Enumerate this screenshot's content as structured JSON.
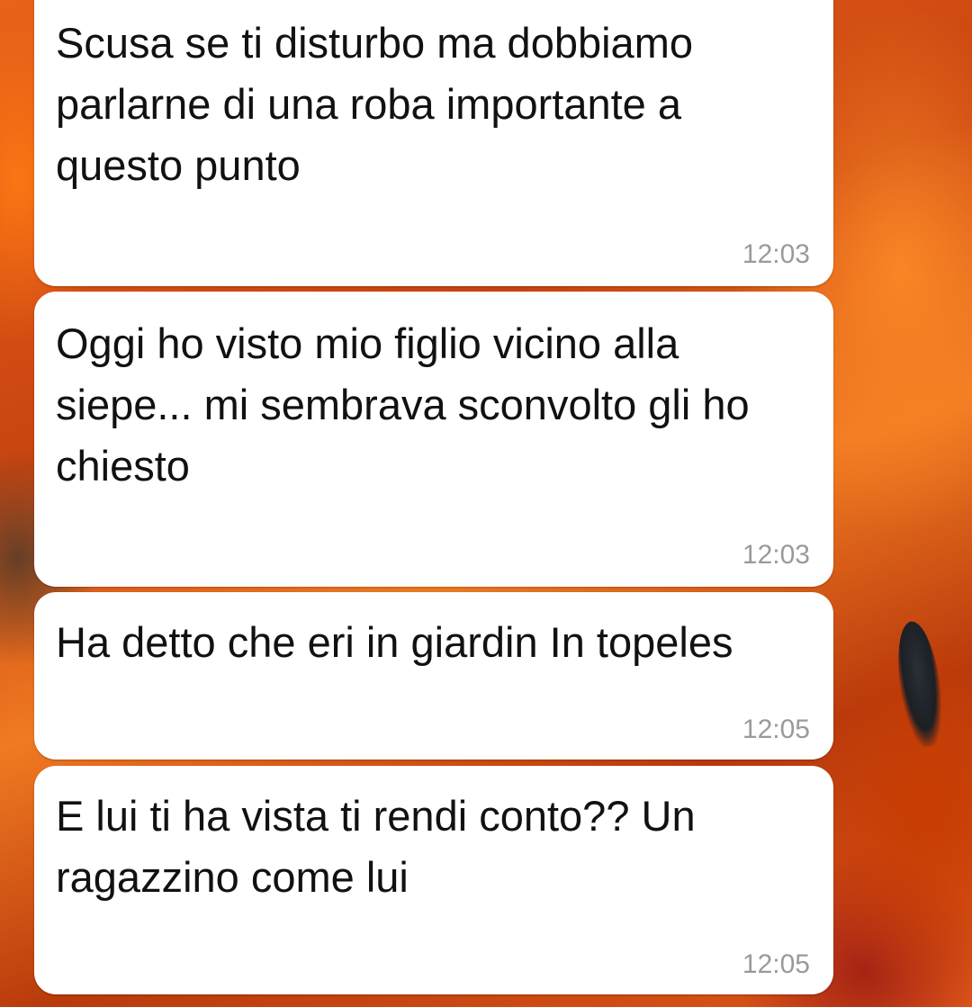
{
  "messages": [
    {
      "text": "Scusa se ti disturbo ma dobbiamo parlarne di una roba importante a questo punto",
      "time": "12:03"
    },
    {
      "text": "Oggi ho visto mio figlio vicino alla siepe... mi sembrava sconvolto gli ho chiesto",
      "time": "12:03"
    },
    {
      "text": "Ha detto che eri in giardin In topeles",
      "time": "12:05"
    },
    {
      "text": "E lui ti ha vista ti rendi conto?? Un ragazzino come lui",
      "time": "12:05"
    }
  ],
  "colors": {
    "bubble_bg": "#ffffff",
    "text": "#111111",
    "timestamp": "#9a9a9a",
    "wallpaper_primary": "#e9631a"
  }
}
